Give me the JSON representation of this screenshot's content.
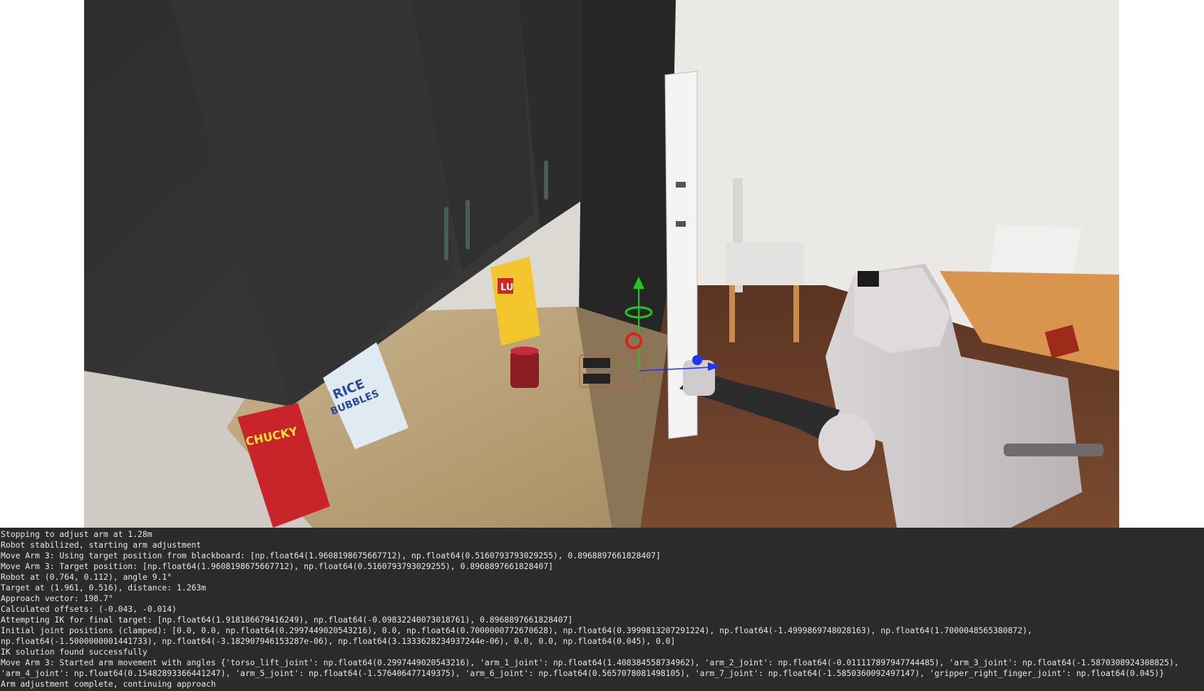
{
  "scene": {
    "label": "3D simulation viewport: kitchen with wall cabinets, counter with cereal boxes and jam jar, refrigerator, dining table and chairs, mobile manipulator robot extending arm toward jar with transform gizmo",
    "objects": {
      "cereal_box_1": "CHUCKY",
      "cereal_box_2": "RICE BUBBLES",
      "wafer_box": "LU",
      "small_box": "box on table"
    }
  },
  "console": {
    "lines": [
      "Stopping to adjust arm at 1.28m",
      "Robot stabilized, starting arm adjustment",
      "Move Arm 3: Using target position from blackboard: [np.float64(1.9608198675667712), np.float64(0.5160793793029255), 0.8968897661828407]",
      "Move Arm 3: Target position: [np.float64(1.9608198675667712), np.float64(0.5160793793029255), 0.8968897661828407]",
      "Robot at (0.764, 0.112), angle 9.1°",
      "Target at (1.961, 0.516), distance: 1.263m",
      "Approach vector: 198.7°",
      "Calculated offsets: (-0.043, -0.014)",
      "Attempting IK for final target: [np.float64(1.918186679416249), np.float64(-0.09832240073018761), 0.8968897661828407]",
      "Initial joint positions (clamped): [0.0, 0.0, np.float64(0.2997449020543216), 0.0, np.float64(0.7000000772670628), np.float64(0.3999813207291224), np.float64(-1.4999869748028163), np.float64(1.7000048565380872),",
      "np.float64(-1.5000000001441733), np.float64(-3.182907946153287e-06), np.float64(3.1333628234937244e-06), 0.0, 0.0, np.float64(0.045), 0.0]",
      "IK solution found successfully",
      "Move Arm 3: Started arm movement with angles {'torso_lift_joint': np.float64(0.2997449020543216), 'arm_1_joint': np.float64(1.408384558734962), 'arm_2_joint': np.float64(-0.011117897947744485), 'arm_3_joint': np.float64(-1.5870308924308825),",
      "'arm_4_joint': np.float64(0.15482893366441247), 'arm_5_joint': np.float64(-1.576406477149375), 'arm_6_joint': np.float64(0.5657078081498105), 'arm_7_joint': np.float64(-1.5850360092497147), 'gripper_right_finger_joint': np.float64(0.045)}",
      "Arm adjustment complete, continuing approach"
    ]
  }
}
